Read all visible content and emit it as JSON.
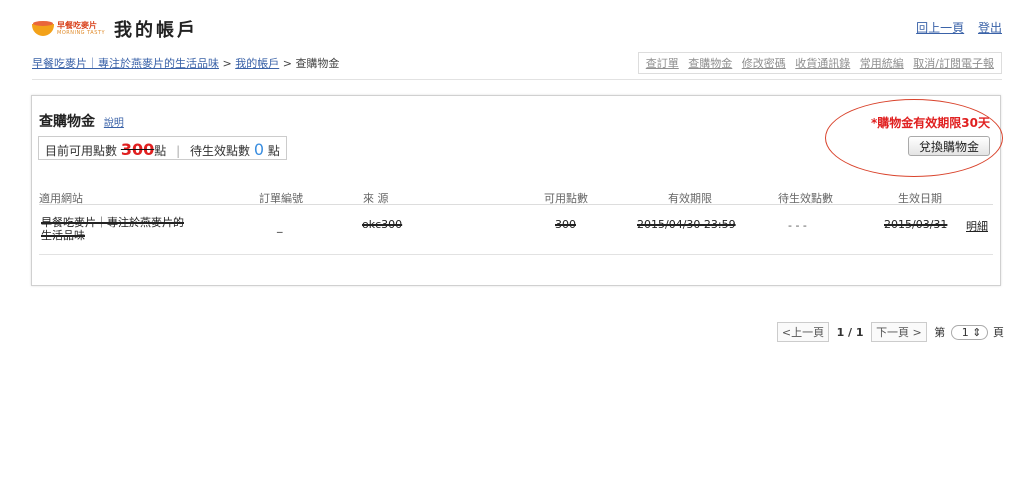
{
  "header": {
    "logo_text": "早餐吃麥片",
    "logo_sub": "MORNING TASTY",
    "title": "我的帳戶",
    "back_link": "回上一頁",
    "logout_link": "登出"
  },
  "breadcrumb": {
    "home": "早餐吃麥片｜專注於燕麥片的生活品味",
    "sep1": ">",
    "account": "我的帳戶",
    "sep2": ">",
    "current": "查購物金"
  },
  "nav_menu": [
    "查訂單",
    "查購物金",
    "修改密碼",
    "收貨通訊錄",
    "常用統編",
    "取消/訂閱電子報"
  ],
  "panel": {
    "title": "查購物金",
    "help_link": "說明",
    "available_label": "目前可用點數",
    "available_value": "300",
    "unit1": "點",
    "pending_label": "待生效點數",
    "pending_value": "0",
    "unit2": "點",
    "validity_star": "*",
    "validity": "購物金有效期限30天",
    "redeem_button": "兌換購物金"
  },
  "table": {
    "headers": [
      "適用網站",
      "訂單編號",
      "來 源",
      "可用點數",
      "有效期限",
      "待生效點數",
      "生效日期"
    ],
    "rows": [
      {
        "site_line1": "早餐吃麥片｜專注於燕麥片的",
        "site_line2": "生活品味",
        "order": "_",
        "source": "okc300",
        "points": "300",
        "expiry": "2015/04/30 23:59",
        "pending": "- - -",
        "effective": "2015/03/31",
        "detail": "明細"
      }
    ]
  },
  "pager": {
    "prev": "<上一頁",
    "page_info": "1 / 1",
    "next": "下一頁 >",
    "page_label": "第",
    "page_select": "1",
    "page_suffix": "頁"
  },
  "colors": {
    "link": "#3a62a8",
    "alert": "#e02020",
    "accent_blue": "#3a8ee0"
  }
}
